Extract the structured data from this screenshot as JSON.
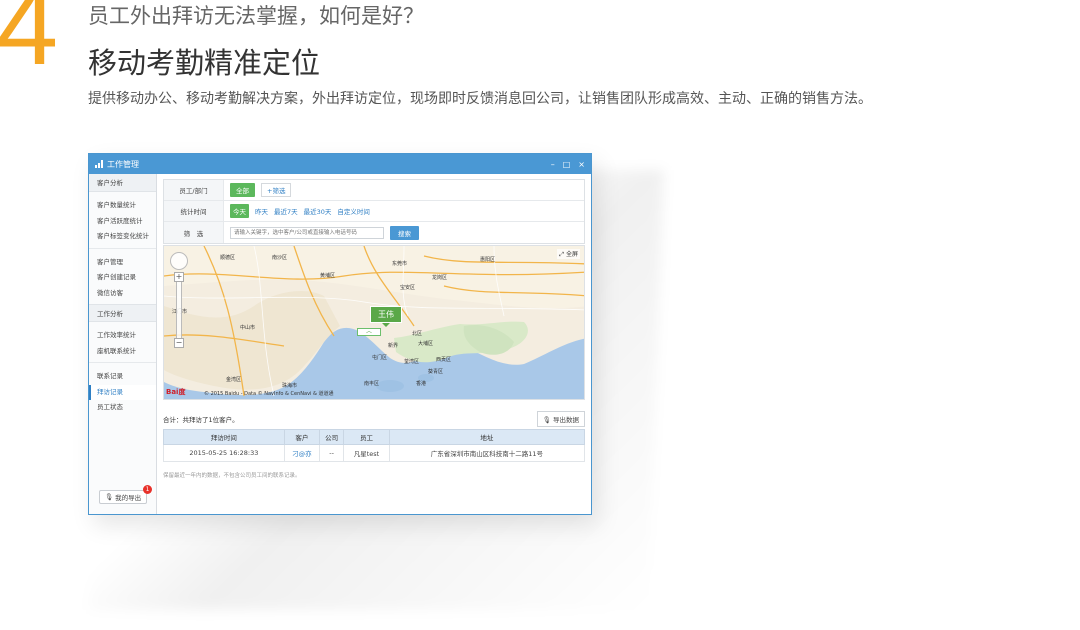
{
  "hero": {
    "step_number": "4",
    "question": "员工外出拜访无法掌握，如何是好？",
    "title": "移动考勤精准定位",
    "description": "提供移动办公、移动考勤解决方案，外出拜访定位，现场即时反馈消息回公司，让销售团队形成高效、主动、正确的销售方法。"
  },
  "window": {
    "title": "工作管理",
    "controls": [
      "–",
      "□",
      "×"
    ]
  },
  "sidebar": {
    "sections": [
      {
        "head": "客户分析",
        "items": [
          "客户数量统计",
          "客户活跃度统计",
          "客户标签变化统计"
        ]
      },
      {
        "head": "",
        "items": [
          "客户管理",
          "客户创建记录",
          "微信访客"
        ]
      },
      {
        "head": "工作分析",
        "items": [
          "工作效率统计",
          "座机联系统计"
        ]
      },
      {
        "head": "",
        "items": [
          "联系记录",
          "拜访记录",
          "员工状态"
        ]
      }
    ],
    "active_item": "拜访记录",
    "export_label": "我的导出",
    "export_badge": "1"
  },
  "filters": {
    "dept_label": "员工/部门",
    "dept_all": "全部",
    "dept_filter": "+筛选",
    "time_label": "统计时间",
    "time_options": [
      "今天",
      "昨天",
      "最近7天",
      "最近30天",
      "自定义时间"
    ],
    "search_label": "筛　选",
    "search_placeholder": "请输入关键字，选中客户/公司或直接输入电话号码",
    "search_button": "搜索"
  },
  "map": {
    "places": [
      "顺德区",
      "南沙区",
      "东莞市",
      "惠阳区",
      "龙岗区",
      "江门市",
      "中山市",
      "宝安区",
      "新界",
      "大埔区",
      "屯门区",
      "荃湾区",
      "西贡区",
      "香港",
      "南丰区",
      "珠海市",
      "金湾区",
      "黄埔区",
      "北区",
      "葵青区"
    ],
    "marker": "王伟",
    "fullscreen": "全屏",
    "baidu": "Bai度",
    "copyright": "© 2015 Baidu - Data © NavInfo & CenNavi & 道道通"
  },
  "summary": {
    "text": "合计：共拜访了1位客户。",
    "export_button": "导出数据"
  },
  "table": {
    "headers": [
      "拜访时间",
      "客户",
      "公司",
      "员工",
      "地址"
    ],
    "rows": [
      [
        "2015-05-25 16:28:33",
        "刁@亦",
        "--",
        "凡星test",
        "广东省深圳市南山区科技南十二路11号"
      ]
    ]
  },
  "note": "保留最近一年内的数据，不包含公司员工间的联系记录。",
  "colors": {
    "accent_orange": "#f5a623",
    "window_blue": "#4a98d4",
    "chip_green": "#5cb85c",
    "link_blue": "#2f7fc4",
    "marker_green": "#5aa848"
  }
}
